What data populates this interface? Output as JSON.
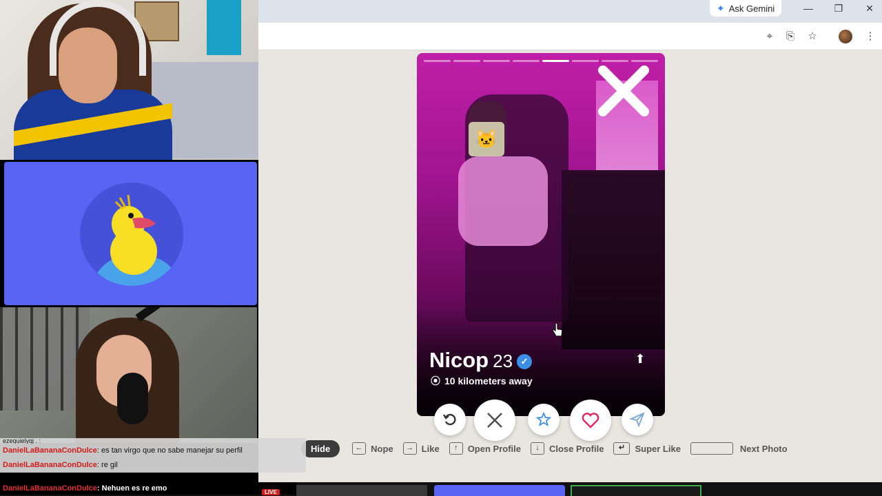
{
  "browser": {
    "gemini_label": "Ask Gemini",
    "window_controls": [
      "minimize-icon",
      "restore-icon",
      "close-icon"
    ],
    "toolbar_icons": [
      "location-pin-icon",
      "install-app-icon",
      "bookmark-star-icon",
      "profile-avatar"
    ]
  },
  "profile": {
    "name": "Nicop",
    "age": "23",
    "distance": "10 kilometers away",
    "photo_count": 8,
    "active_photo": 5
  },
  "actions": [
    {
      "name": "rewind-button",
      "icon": "rewind-icon"
    },
    {
      "name": "nope-button",
      "icon": "x-icon"
    },
    {
      "name": "super-like-button",
      "icon": "star-icon"
    },
    {
      "name": "like-button",
      "icon": "heart-icon"
    },
    {
      "name": "boost-button",
      "icon": "send-icon"
    }
  ],
  "shortcuts": {
    "hide": "Hide",
    "nope": "Nope",
    "like": "Like",
    "open_profile": "Open Profile",
    "close_profile": "Close Profile",
    "super_like": "Super Like",
    "next_photo": "Next Photo"
  },
  "chat": {
    "partial_line": "ezequielyqj . :",
    "messages": [
      {
        "user": "DanielLaBananaConDulce",
        "text": ": es tan virgo que no sabe manejar su perfil"
      },
      {
        "user": "DanielLaBananaConDulce",
        "text": ": re gil"
      },
      {
        "user": "DanielLaBananaConDulce",
        "text": ": Nehuen es re emo"
      }
    ]
  },
  "stream": {
    "live_badge": "LIVE"
  },
  "colors": {
    "accent_blue": "#5865f2",
    "like_red": "#e0245e",
    "superlike_blue": "#3d8ee6",
    "nope_gray": "#505050"
  }
}
